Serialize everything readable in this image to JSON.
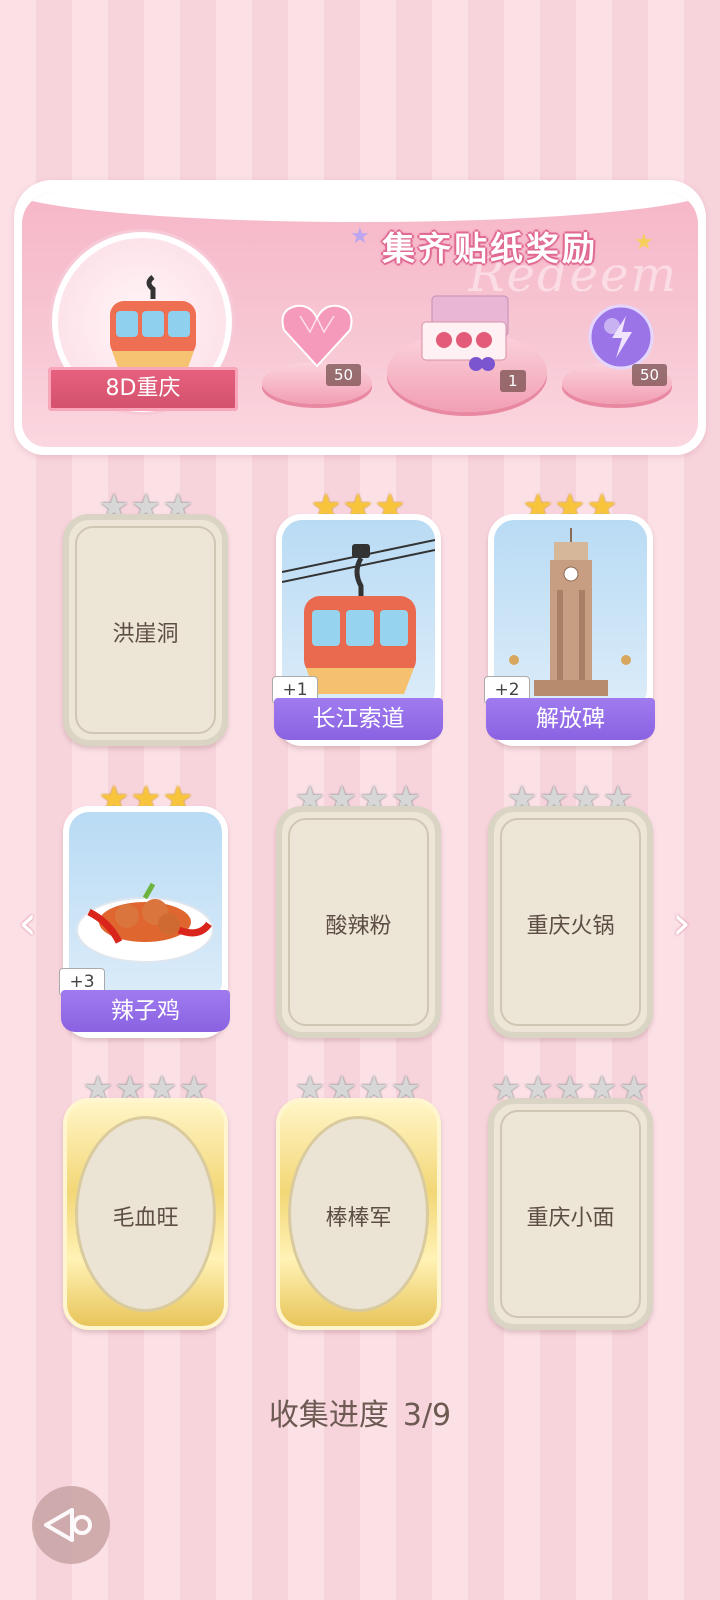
{
  "banner": {
    "title": "集齐贴纸奖励",
    "watermark": "Redeem",
    "city": "8D重庆",
    "rewards": [
      {
        "icon": "heart-gem-icon",
        "count": "50"
      },
      {
        "icon": "gift-box-icon",
        "count": "1"
      },
      {
        "icon": "lightning-orb-icon",
        "count": "50"
      }
    ]
  },
  "cards": [
    {
      "name": "洪崖洞",
      "stars_total": 3,
      "stars_on": 0,
      "state": "empty"
    },
    {
      "name": "长江索道",
      "stars_total": 3,
      "stars_on": 3,
      "state": "filled",
      "plus": "+1",
      "art": "gondola"
    },
    {
      "name": "解放碑",
      "stars_total": 3,
      "stars_on": 3,
      "state": "filled",
      "plus": "+2",
      "art": "tower"
    },
    {
      "name": "辣子鸡",
      "stars_total": 3,
      "stars_on": 3,
      "state": "filled",
      "plus": "+3",
      "art": "food"
    },
    {
      "name": "酸辣粉",
      "stars_total": 4,
      "stars_on": 0,
      "state": "empty"
    },
    {
      "name": "重庆火锅",
      "stars_total": 4,
      "stars_on": 0,
      "state": "empty"
    },
    {
      "name": "毛血旺",
      "stars_total": 4,
      "stars_on": 0,
      "state": "gold"
    },
    {
      "name": "棒棒军",
      "stars_total": 4,
      "stars_on": 0,
      "state": "gold"
    },
    {
      "name": "重庆小面",
      "stars_total": 5,
      "stars_on": 0,
      "state": "empty"
    }
  ],
  "progress": {
    "label": "收集进度",
    "value": "3/9"
  },
  "nav": {
    "prev": "‹",
    "next": "›"
  }
}
